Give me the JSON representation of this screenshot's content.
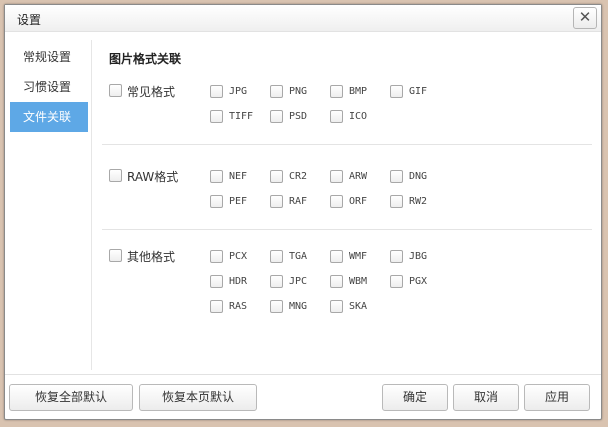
{
  "window": {
    "title": "设置",
    "close_glyph": "✕"
  },
  "sidebar": {
    "items": [
      {
        "label": "常规设置"
      },
      {
        "label": "习惯设置"
      },
      {
        "label": "文件关联"
      }
    ],
    "active_index": 2,
    "active_color": "#5ea8e6"
  },
  "content": {
    "section_title": "图片格式关联",
    "groups": [
      {
        "label": "常见格式",
        "formats": [
          "JPG",
          "PNG",
          "BMP",
          "GIF",
          "TIFF",
          "PSD",
          "ICO"
        ]
      },
      {
        "label": "RAW格式",
        "formats": [
          "NEF",
          "CR2",
          "ARW",
          "DNG",
          "PEF",
          "RAF",
          "ORF",
          "RW2"
        ]
      },
      {
        "label": "其他格式",
        "formats": [
          "PCX",
          "TGA",
          "WMF",
          "JBG",
          "HDR",
          "JPC",
          "WBM",
          "PGX",
          "RAS",
          "MNG",
          "SKA"
        ]
      }
    ]
  },
  "footer": {
    "restore_all_label": "恢复全部默认",
    "restore_page_label": "恢复本页默认",
    "ok_label": "确定",
    "cancel_label": "取消",
    "apply_label": "应用"
  }
}
